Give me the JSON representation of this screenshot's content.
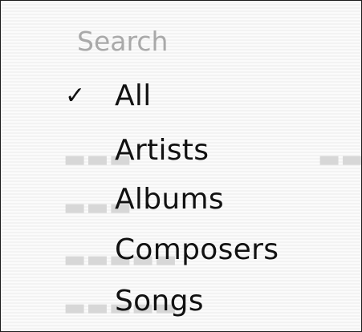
{
  "menu": {
    "header": "Search",
    "items": [
      {
        "label": "All",
        "check": "✓"
      },
      {
        "label": "Artists",
        "check": ""
      },
      {
        "label": "Albums",
        "check": ""
      },
      {
        "label": "Composers",
        "check": ""
      },
      {
        "label": "Songs",
        "check": ""
      }
    ],
    "colors": {
      "header_text": "#a9a9a9",
      "item_text": "#111111",
      "background": "#f3f3f3",
      "border": "#1c1c1c"
    }
  }
}
